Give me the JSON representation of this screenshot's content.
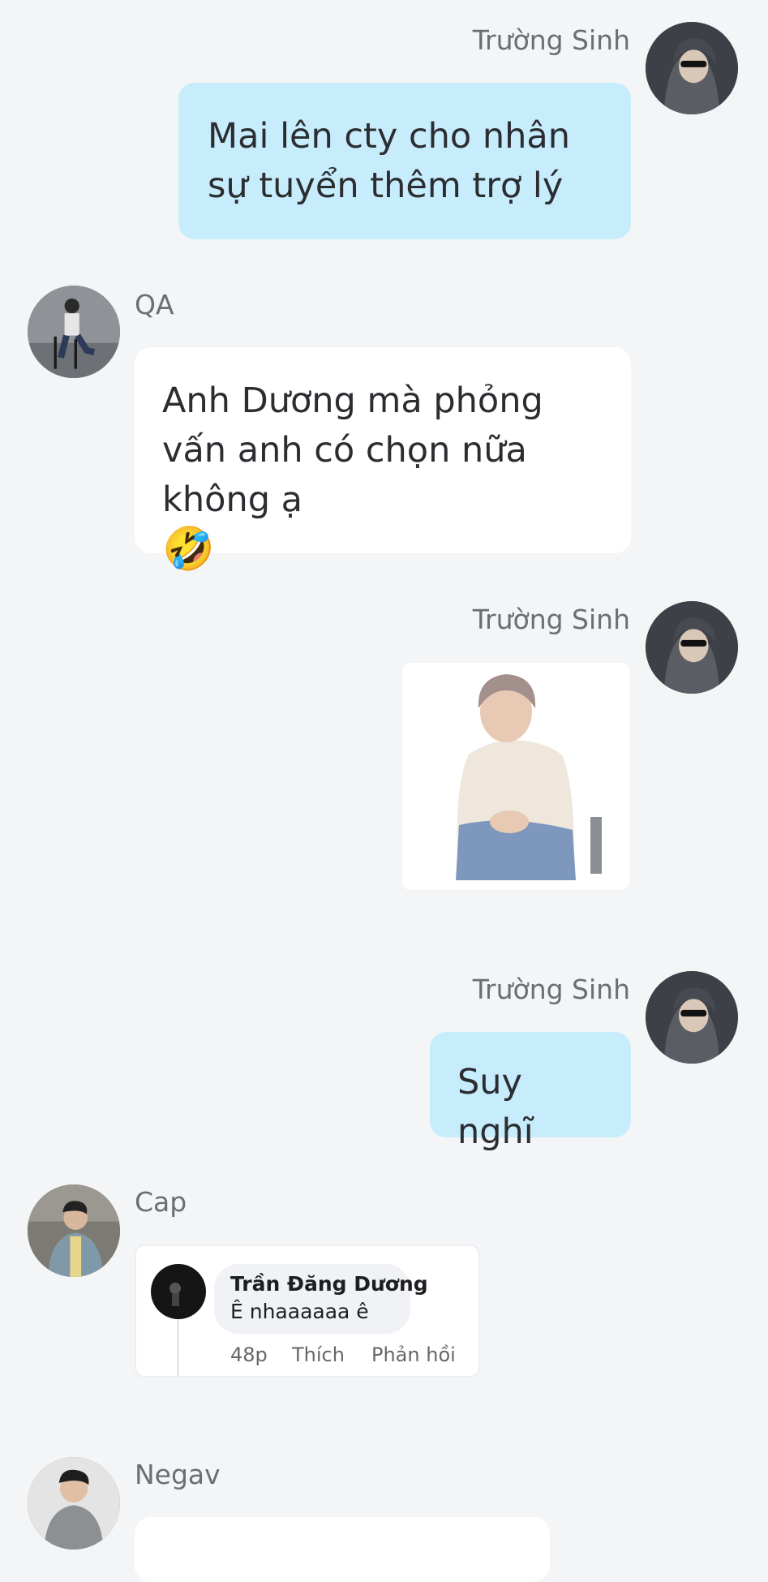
{
  "messages": [
    {
      "sender": "Trường Sinh",
      "text": "Mai lên cty cho nhân sự tuyển thêm trợ lý"
    },
    {
      "sender": "QA",
      "text": "Anh Dương mà phỏng vấn anh có chọn nữa không ạ",
      "emoji": "🤣"
    },
    {
      "sender": "Trường Sinh",
      "sticker": "person-sitting-sticker"
    },
    {
      "sender": "Trường Sinh",
      "text": "Suy nghĩ"
    },
    {
      "sender": "Cap",
      "shared_comment": {
        "author": "Trần Đăng Dương",
        "text": "Ê nhaaaaaa ê",
        "time": "48p",
        "like": "Thích",
        "reply": "Phản hồi"
      }
    },
    {
      "sender": "Negav",
      "text": ""
    }
  ],
  "colors": {
    "my_bubble": "#c7edfd",
    "their_bubble": "#ffffff",
    "background": "#f4f5f7"
  }
}
